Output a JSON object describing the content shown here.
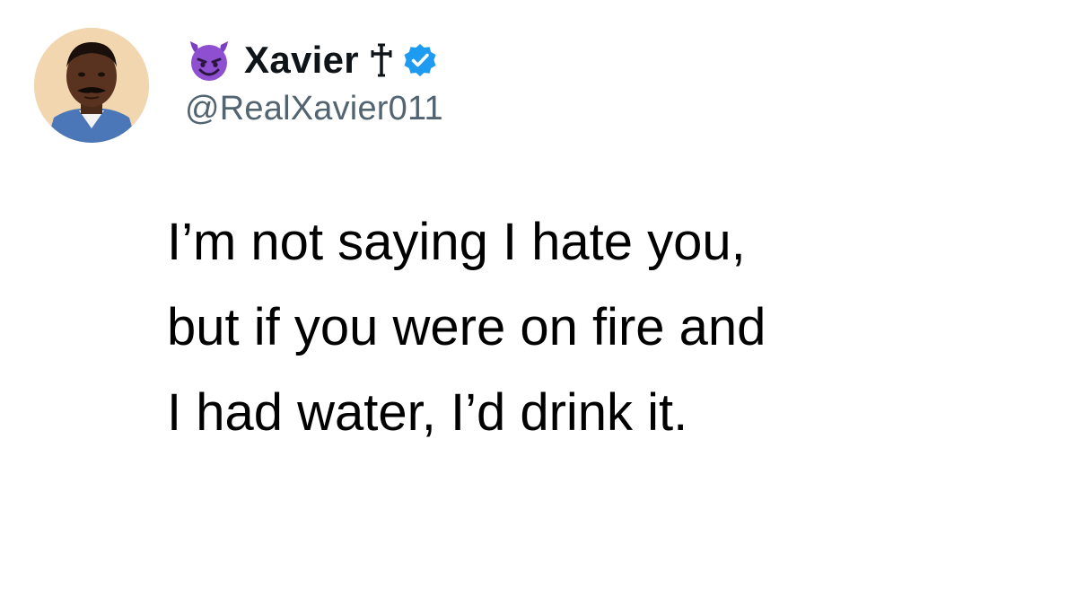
{
  "author": {
    "display_name": "Xavier",
    "handle": "@RealXavier011",
    "avatar_icon": "profile-photo",
    "name_prefix_icon": "smiling-devil-emoji",
    "name_suffix_icon": "latin-cross-icon",
    "verified_icon": "verified-badge",
    "verified_color": "#1d9bf0"
  },
  "tweet": {
    "lines": [
      "I’m not saying I hate you,",
      "but if you were on fire and",
      "I had water, I’d drink it."
    ]
  }
}
